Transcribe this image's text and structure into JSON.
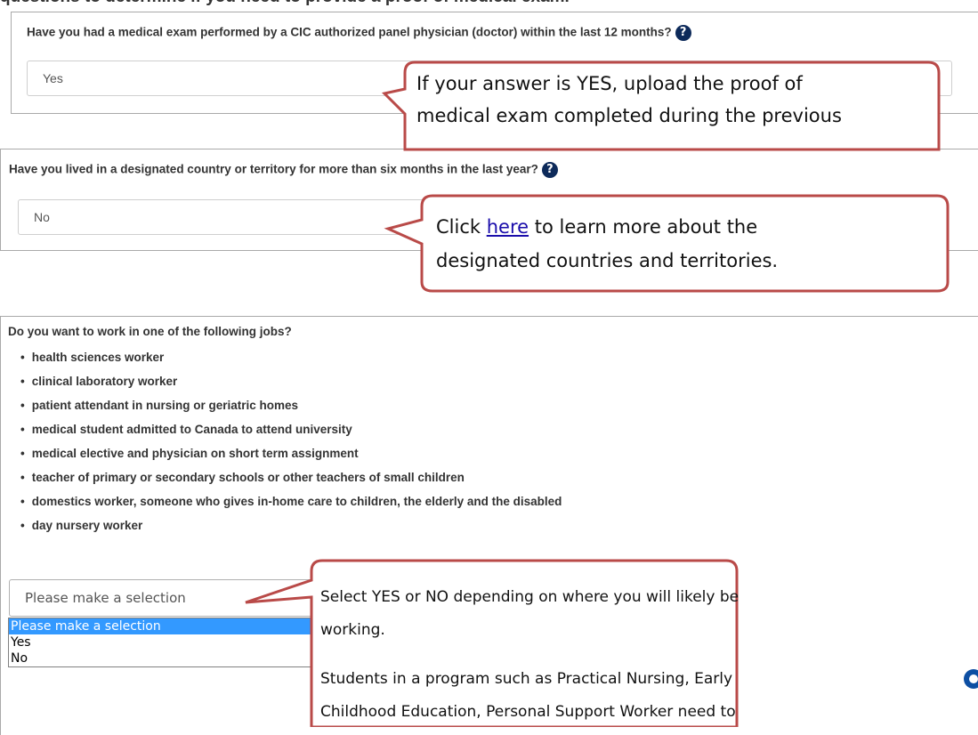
{
  "cut_off_text": "questions to determine if you need to provide a proof of medical exam.",
  "section1": {
    "question": "Have you had a medical exam performed by a CIC authorized panel physician (doctor) within the last 12 months?",
    "help_icon": "question-circle-icon",
    "selected_value": "Yes"
  },
  "section2": {
    "question": "Have you lived in a designated country or territory for more than six months in the last year?",
    "help_icon": "question-circle-icon",
    "selected_value": "No"
  },
  "section3": {
    "question": "Do you want to work in one of the following jobs?",
    "jobs": [
      "health sciences worker",
      "clinical laboratory worker",
      "patient attendant in nursing or geriatric homes",
      "medical student admitted to Canada to attend university",
      "medical elective and physician on short term assignment",
      "teacher of primary or secondary schools or other teachers of small children",
      "domestics worker, someone who gives in-home care to children, the elderly and the disabled",
      "day nursery worker"
    ],
    "select_value": "Please make a selection",
    "options": [
      "Please make a selection",
      "Yes",
      "No"
    ]
  },
  "callout1": {
    "line1": "If your answer is YES, upload the proof of",
    "line2": "medical exam completed during the previous"
  },
  "callout2": {
    "pre_link": "Click ",
    "link": "here",
    "post_link": " to learn more about the",
    "line2": "designated countries and territories."
  },
  "callout3": {
    "line1": "Select YES or NO depending on where you will likely be",
    "line2": "working.",
    "line3": "Students in a program such as Practical Nursing, Early",
    "line4": "Childhood Education, Personal Support Worker need to"
  },
  "colors": {
    "callout_border": "#b94a48",
    "dropdown_highlight": "#3399ff",
    "help_icon": "#0d2a5a",
    "link": "#1a0dab"
  }
}
